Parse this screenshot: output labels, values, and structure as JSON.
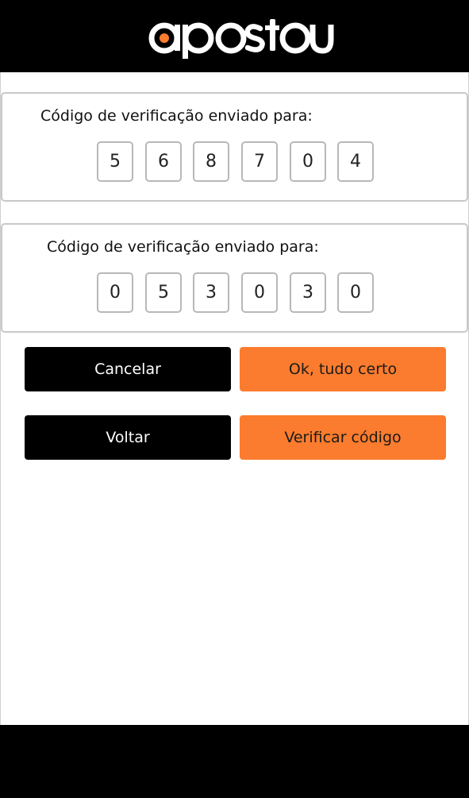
{
  "header": {
    "logo_text": "apostou",
    "colors": {
      "background": "#000000",
      "logo": "#ffffff",
      "accent": "#FB7C2E"
    }
  },
  "card_first": {
    "label": "Código de verificação enviado para:",
    "digits": [
      "5",
      "6",
      "8",
      "7",
      "0",
      "4"
    ]
  },
  "card_second": {
    "label": "Código de verificação enviado para:",
    "digits": [
      "0",
      "5",
      "3",
      "0",
      "3",
      "0"
    ]
  },
  "buttons": {
    "cancel": "Cancelar",
    "ok": "Ok, tudo certo",
    "back": "Voltar",
    "verify": "Verificar código"
  },
  "colors": {
    "primary_black": "#000000",
    "primary_orange": "#FB7C2E",
    "card_border": "#c8c8c8"
  }
}
